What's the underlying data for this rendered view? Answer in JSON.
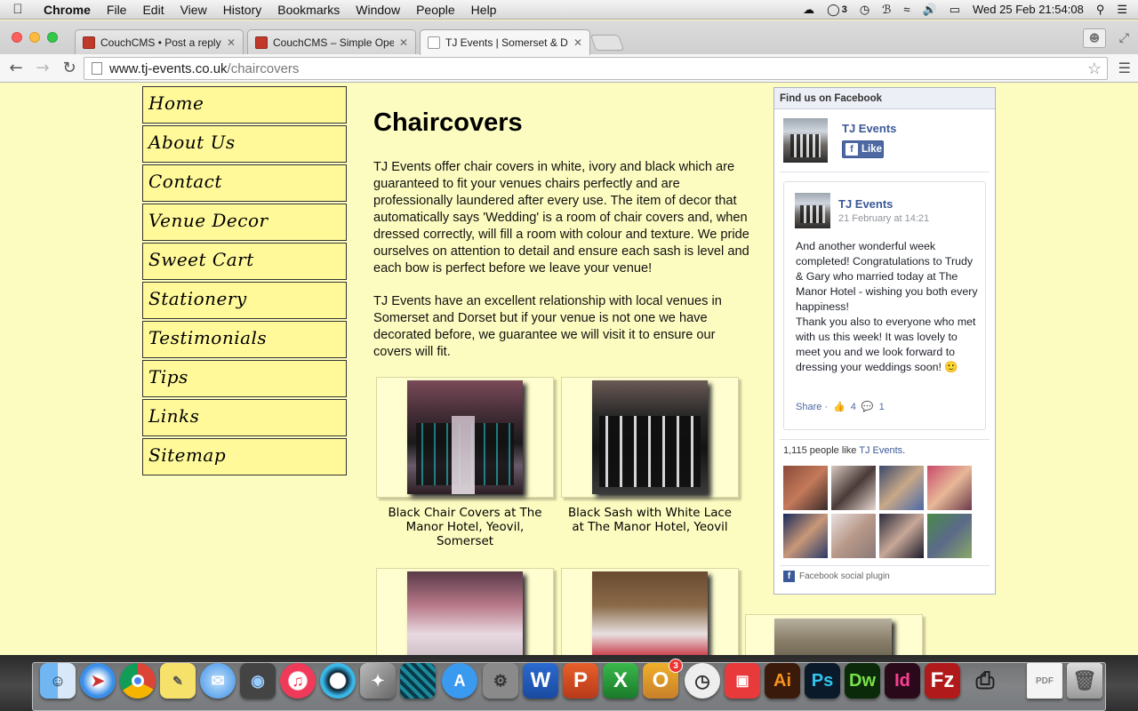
{
  "menubar": {
    "apple_icon": "apple-logo-icon",
    "items": [
      {
        "label": "Chrome",
        "bold": true
      },
      {
        "label": "File"
      },
      {
        "label": "Edit"
      },
      {
        "label": "View"
      },
      {
        "label": "History"
      },
      {
        "label": "Bookmarks"
      },
      {
        "label": "Window"
      },
      {
        "label": "People"
      },
      {
        "label": "Help"
      }
    ],
    "status": {
      "badge_count": "3",
      "datetime": "Wed 25 Feb  21:54:08"
    }
  },
  "tabs": [
    {
      "title": "CouchCMS • Post a reply",
      "close": "✕"
    },
    {
      "title": "CouchCMS – Simple Open",
      "close": "✕"
    },
    {
      "title": "TJ Events | Somerset & Dor",
      "close": "✕"
    }
  ],
  "toolbar": {
    "url_host": "www.tj-events.co.uk",
    "url_path": "/chaircovers"
  },
  "sidenav": [
    "Home",
    "About Us",
    "Contact",
    "Venue Decor",
    "Sweet Cart",
    "Stationery",
    "Testimonials",
    "Tips",
    "Links",
    "Sitemap"
  ],
  "content": {
    "title": "Chaircovers",
    "paragraphs": [
      "TJ Events offer chair covers in white, ivory and black which are guaranteed to fit your venues chairs perfectly and are professionally laundered after every use. The item of decor that automatically says 'Wedding' is a room of chair covers and, when dressed correctly, will fill a room with colour and texture. We pride ourselves on attention to detail and ensure each sash is level and each bow is perfect before we leave your venue!",
      "TJ Events have an excellent relationship with local venues in Somerset and Dorset but if your venue is not one we have decorated before, we guarantee we will visit it to ensure our covers will fit."
    ],
    "gallery": [
      {
        "caption": "Black Chair Covers at The Manor Hotel, Yeovil, Somerset"
      },
      {
        "caption": "Black Sash with White Lace at The Manor Hotel, Yeovil"
      },
      {
        "caption": ""
      },
      {
        "caption": ""
      }
    ]
  },
  "facebook": {
    "header": "Find us on Facebook",
    "page_name": "TJ Events",
    "like_label": "Like",
    "post": {
      "author": "TJ Events",
      "date": "21 February at 14:21",
      "body_lines": [
        "And another wonderful week completed! Congratulations to Trudy & Gary who married today at The Manor Hotel - wishing you both every happiness!",
        "Thank you also to everyone who met with us this week! It was lovely to meet you and we look forward to dressing your weddings soon! 🙂"
      ],
      "share_label": "Share ·",
      "like_count": "4",
      "comment_count": "1"
    },
    "likes_prefix": "1,115 people like ",
    "likes_page": "TJ Events",
    "likes_suffix": ".",
    "plugin_label": "Facebook social plugin"
  },
  "dock": {
    "badge": "3"
  }
}
